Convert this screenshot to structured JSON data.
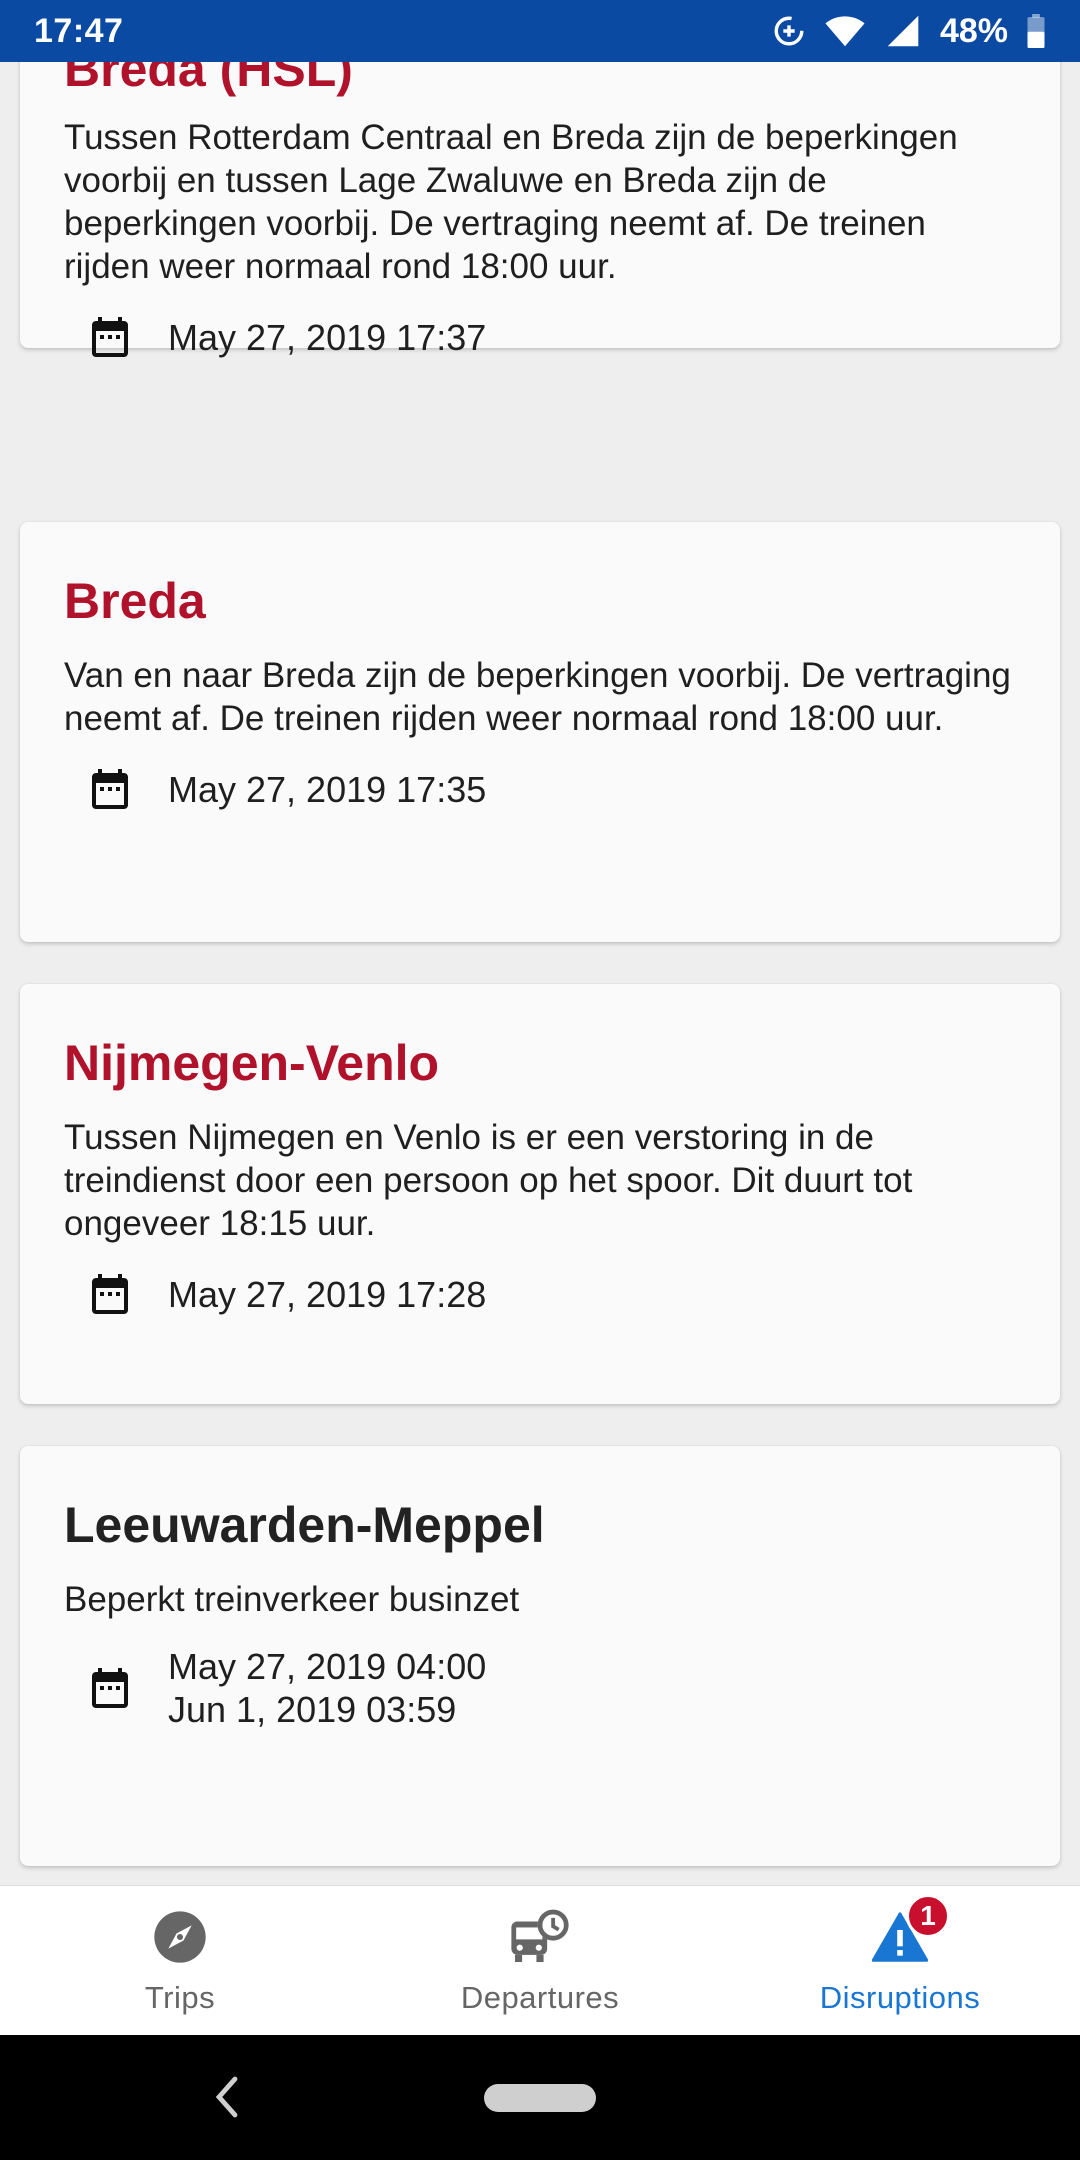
{
  "status_bar": {
    "time": "17:47",
    "battery": "48%",
    "icons": [
      "data-saver-icon",
      "wifi-icon",
      "cell-signal-icon",
      "battery-icon"
    ]
  },
  "disruptions": [
    {
      "title": "Dordrecht-Breda, Rotterdam-Breda (HSL)",
      "title_color": "#b0122b",
      "body": "Tussen Rotterdam Centraal en Breda zijn de beperkingen voorbij en tussen Lage Zwaluwe en Breda zijn de beperkingen voorbij. De vertraging neemt af. De treinen rijden weer normaal rond 18:00 uur.",
      "dates": [
        "May 27, 2019 17:37"
      ]
    },
    {
      "title": "Breda",
      "title_color": "#b0122b",
      "body": "Van en naar Breda zijn de beperkingen voorbij. De vertraging neemt af. De treinen rijden weer normaal rond 18:00 uur.",
      "dates": [
        "May 27, 2019 17:35"
      ]
    },
    {
      "title": "Nijmegen-Venlo",
      "title_color": "#b0122b",
      "body": "Tussen Nijmegen en Venlo is er een verstoring in de treindienst door een persoon op het spoor. Dit duurt tot ongeveer 18:15 uur.",
      "dates": [
        "May 27, 2019 17:28"
      ]
    },
    {
      "title": "Leeuwarden-Meppel",
      "title_color": "#222222",
      "body": "Beperkt treinverkeer businzet",
      "dates": [
        "May 27, 2019 04:00",
        "Jun 1, 2019 03:59"
      ]
    }
  ],
  "bottom_nav": {
    "items": [
      {
        "label": "Trips",
        "icon": "compass-icon",
        "active": false
      },
      {
        "label": "Departures",
        "icon": "bus-clock-icon",
        "active": false
      },
      {
        "label": "Disruptions",
        "icon": "warning-icon",
        "active": true,
        "badge": "1"
      }
    ],
    "active_color": "#1976d2",
    "badge_color": "#c8102e"
  },
  "system_nav": {
    "icons": [
      "back-icon",
      "home-pill-icon"
    ]
  }
}
